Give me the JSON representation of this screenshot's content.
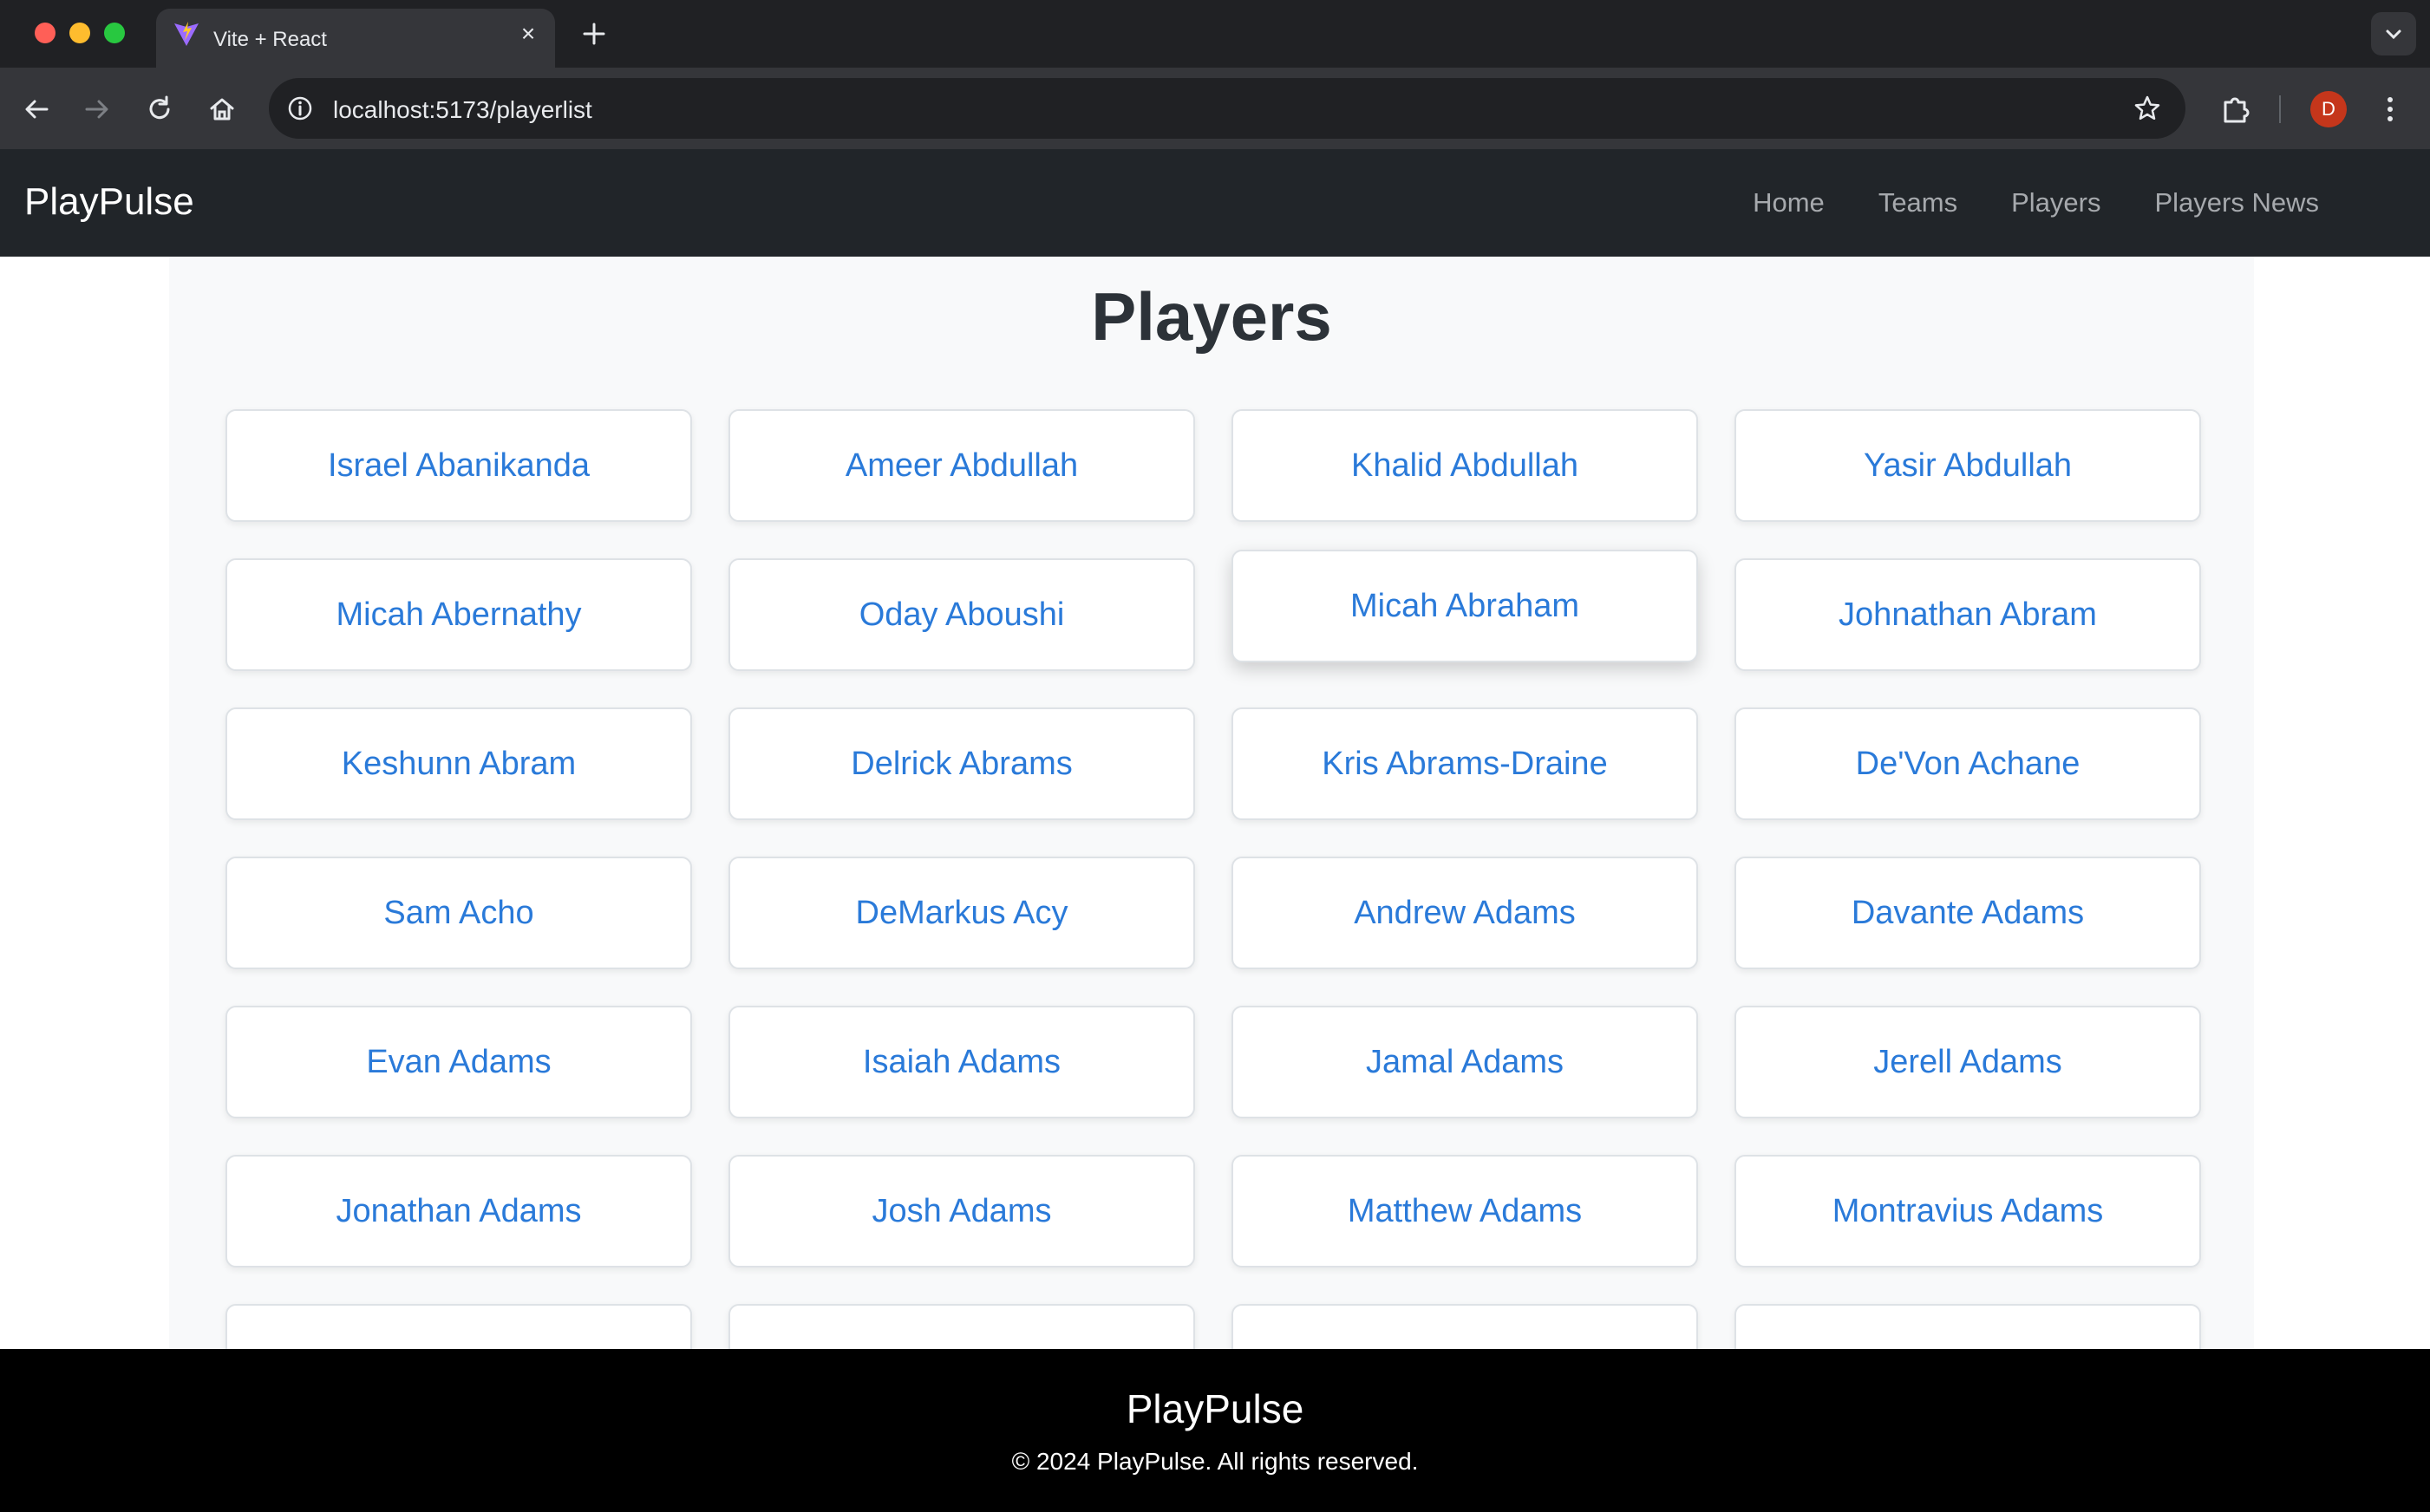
{
  "browser": {
    "tab_title": "Vite + React",
    "url": "localhost:5173/playerlist",
    "profile_initial": "D"
  },
  "navbar": {
    "brand": "PlayPulse",
    "links": [
      "Home",
      "Teams",
      "Players",
      "Players News"
    ]
  },
  "page": {
    "heading": "Players",
    "players": [
      "Israel Abanikanda",
      "Ameer Abdullah",
      "Khalid Abdullah",
      "Yasir Abdullah",
      "Micah Abernathy",
      "Oday Aboushi",
      "Micah Abraham",
      "Johnathan Abram",
      "Keshunn Abram",
      "Delrick Abrams",
      "Kris Abrams-Draine",
      "De'Von Achane",
      "Sam Acho",
      "DeMarkus Acy",
      "Andrew Adams",
      "Davante Adams",
      "Evan Adams",
      "Isaiah Adams",
      "Jamal Adams",
      "Jerell Adams",
      "Jonathan Adams",
      "Josh Adams",
      "Matthew Adams",
      "Montravius Adams"
    ],
    "hovered_player": "Micah Abraham"
  },
  "footer": {
    "brand": "PlayPulse",
    "copyright": "© 2024 PlayPulse. All rights reserved."
  },
  "colors": {
    "navbar_bg": "#212529",
    "link_blue": "#2a7ad9",
    "footer_bg": "#000000",
    "content_bg": "#f8f9fa"
  }
}
